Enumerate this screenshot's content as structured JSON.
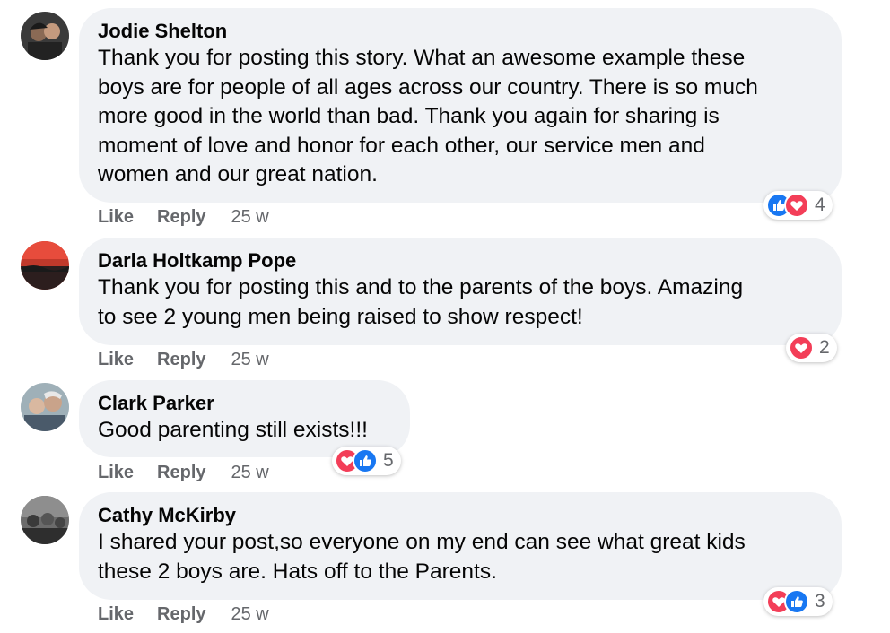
{
  "comments": [
    {
      "author": "Jodie Shelton",
      "lines": [
        "Thank you for posting this story. What an awesome example these",
        "boys are for people of all ages across our country. There is so much",
        "more good in the world than bad. Thank you again for sharing is",
        "moment of love and honor for each other, our service men and",
        "women and our great nation."
      ],
      "like_label": "Like",
      "reply_label": "Reply",
      "timestamp": "25 w",
      "reactions": [
        "like-icon",
        "love-icon"
      ],
      "reaction_count": "4"
    },
    {
      "author": "Darla Holtkamp Pope",
      "lines": [
        "Thank you for posting this and to the parents of the boys. Amazing",
        "to see 2 young men being raised to show respect!"
      ],
      "like_label": "Like",
      "reply_label": "Reply",
      "timestamp": "25 w",
      "reactions": [
        "love-icon"
      ],
      "reaction_count": "2"
    },
    {
      "author": "Clark Parker",
      "lines": [
        "Good parenting still exists!!!"
      ],
      "like_label": "Like",
      "reply_label": "Reply",
      "timestamp": "25 w",
      "reactions": [
        "love-icon",
        "like-icon"
      ],
      "reaction_count": "5"
    },
    {
      "author": "Cathy McKirby",
      "lines": [
        "I shared your post,so everyone on my end can see what great kids",
        "these 2 boys are. Hats off to the Parents."
      ],
      "like_label": "Like",
      "reply_label": "Reply",
      "timestamp": "25 w",
      "reactions": [
        "love-icon",
        "like-icon"
      ],
      "reaction_count": "3"
    }
  ],
  "colors": {
    "bubble": "#f0f2f5",
    "like_blue": "#1877f2",
    "love_red": "#f33e58",
    "meta_gray": "#65676b"
  }
}
